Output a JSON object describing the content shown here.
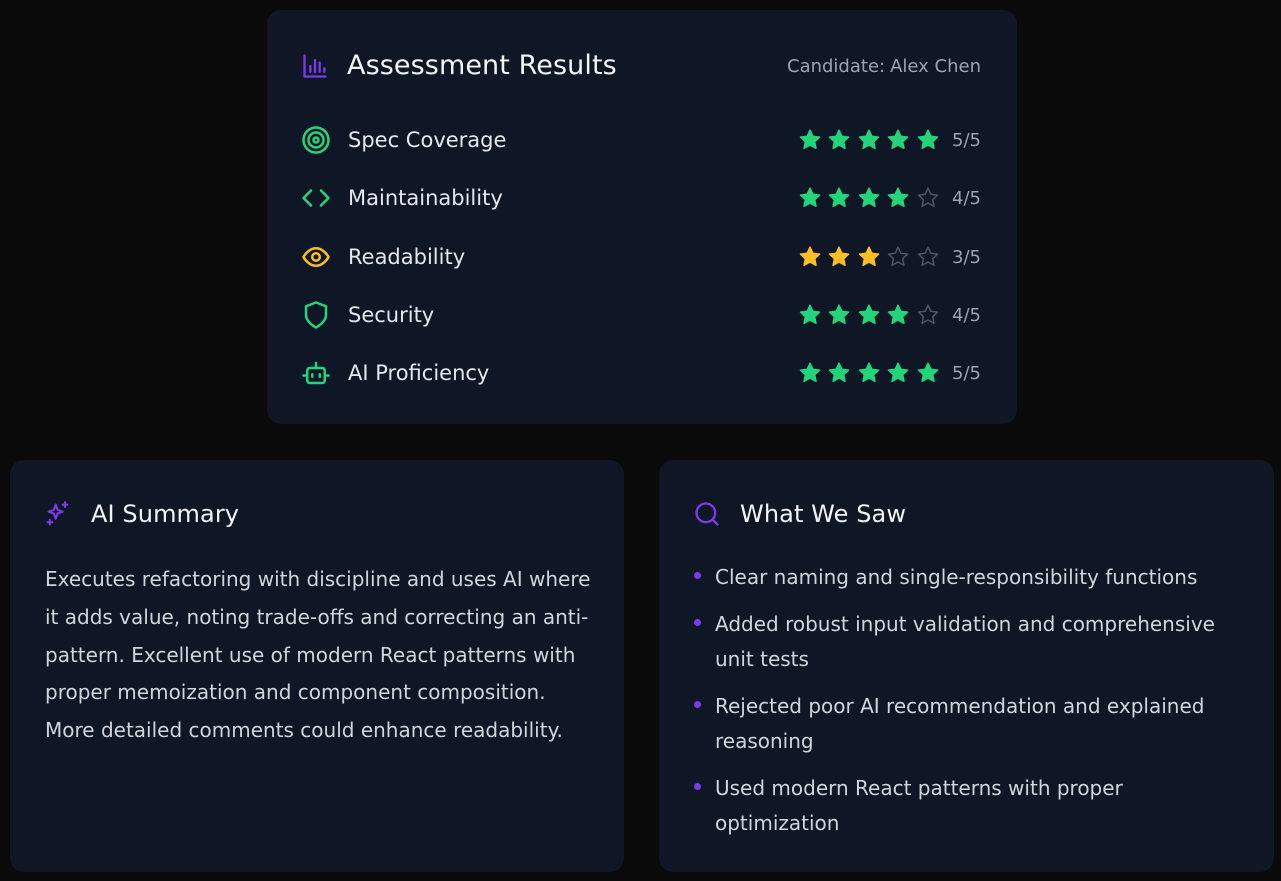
{
  "colors": {
    "background": "#0a0a0b",
    "card": "#0f1726",
    "green": "#22d47a",
    "yellow": "#fbbf24",
    "purple": "#7c3aed",
    "star_empty": "#4b5563"
  },
  "results": {
    "title": "Assessment Results",
    "title_icon": "bar-chart-icon",
    "candidate_prefix": "Candidate:",
    "candidate_name": "Alex Chen",
    "metrics": [
      {
        "label": "Spec Coverage",
        "icon": "target-icon",
        "rating": 5,
        "max": 5,
        "score_text": "5/5",
        "color": "#22d47a"
      },
      {
        "label": "Maintainability",
        "icon": "code-icon",
        "rating": 4,
        "max": 5,
        "score_text": "4/5",
        "color": "#22d47a"
      },
      {
        "label": "Readability",
        "icon": "eye-icon",
        "rating": 3,
        "max": 5,
        "score_text": "3/5",
        "color": "#fbbf24"
      },
      {
        "label": "Security",
        "icon": "shield-icon",
        "rating": 4,
        "max": 5,
        "score_text": "4/5",
        "color": "#22d47a"
      },
      {
        "label": "AI Proficiency",
        "icon": "bot-icon",
        "rating": 5,
        "max": 5,
        "score_text": "5/5",
        "color": "#22d47a"
      }
    ]
  },
  "summary": {
    "title": "AI Summary",
    "title_icon": "sparkles-icon",
    "text": "Executes refactoring with discipline and uses AI where it adds value, noting trade-offs and correcting an anti-pattern. Excellent use of modern React patterns with proper memoization and component composition. More detailed comments could enhance readability."
  },
  "what_we_saw": {
    "title": "What We Saw",
    "title_icon": "search-icon",
    "items": [
      "Clear naming and single-responsibility functions",
      "Added robust input validation and comprehensive unit tests",
      "Rejected poor AI recommendation and explained reasoning",
      "Used modern React patterns with proper optimization"
    ]
  }
}
